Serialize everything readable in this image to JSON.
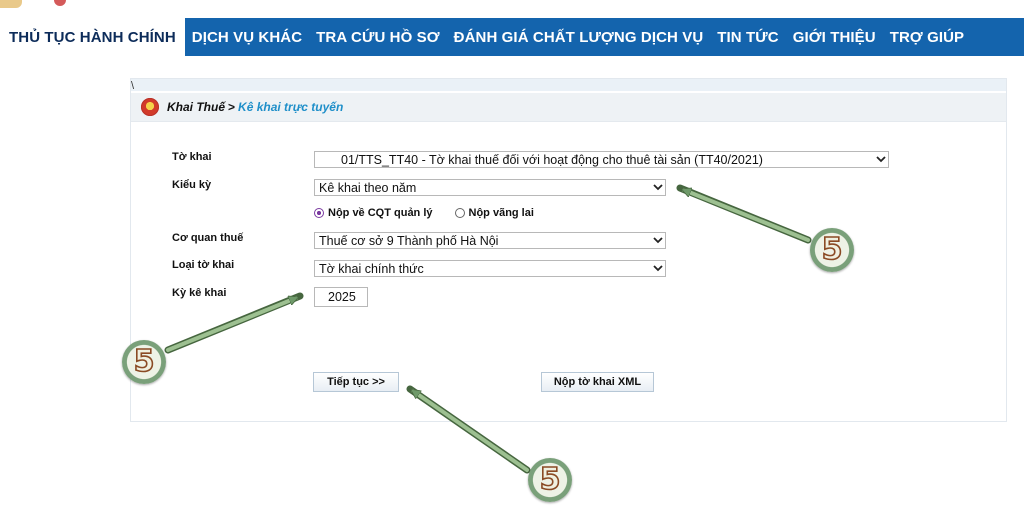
{
  "nav": {
    "items": [
      {
        "label": "THỦ TỤC HÀNH CHÍNH",
        "active": true
      },
      {
        "label": "DỊCH VỤ KHÁC",
        "active": false
      },
      {
        "label": "TRA CỨU HỒ SƠ",
        "active": false
      },
      {
        "label": "ĐÁNH GIÁ CHẤT LƯỢNG DỊCH VỤ",
        "active": false
      },
      {
        "label": "TIN TỨC",
        "active": false
      },
      {
        "label": "GIỚI THIỆU",
        "active": false
      },
      {
        "label": "TRỢ GIÚP",
        "active": false
      }
    ]
  },
  "panel": {
    "backslash": "\\",
    "breadcrumb": {
      "main": "Khai Thuế",
      "separator": ">",
      "current": "Kê khai trực tuyến"
    }
  },
  "form": {
    "to_khai": {
      "label": "Tờ khai",
      "value": "01/TTS_TT40 - Tờ khai thuế đối với hoạt động cho thuê tài sản (TT40/2021)"
    },
    "kieu_ky": {
      "label": "Kiểu kỳ",
      "value": "Kê khai theo năm"
    },
    "radio": {
      "option1": "Nộp về CQT quản lý",
      "option2": "Nộp vãng lai",
      "selected": "option1"
    },
    "co_quan_thue": {
      "label": "Cơ quan thuế",
      "value": "Thuế cơ sở 9 Thành phố Hà Nội"
    },
    "loai_to_khai": {
      "label": "Loại tờ khai",
      "value": "Tờ khai chính thức"
    },
    "ky_ke_khai": {
      "label": "Kỳ kê khai",
      "value": "2025"
    },
    "buttons": {
      "continue": "Tiếp tục >>",
      "submit_xml": "Nộp tờ khai XML"
    }
  },
  "annotations": {
    "badge_text": "5",
    "arrow_color": "#6f9a6a",
    "badge_ring_color": "#7aa07a"
  },
  "colors": {
    "navbar": "#1464ad",
    "link": "#1f8fc9"
  }
}
